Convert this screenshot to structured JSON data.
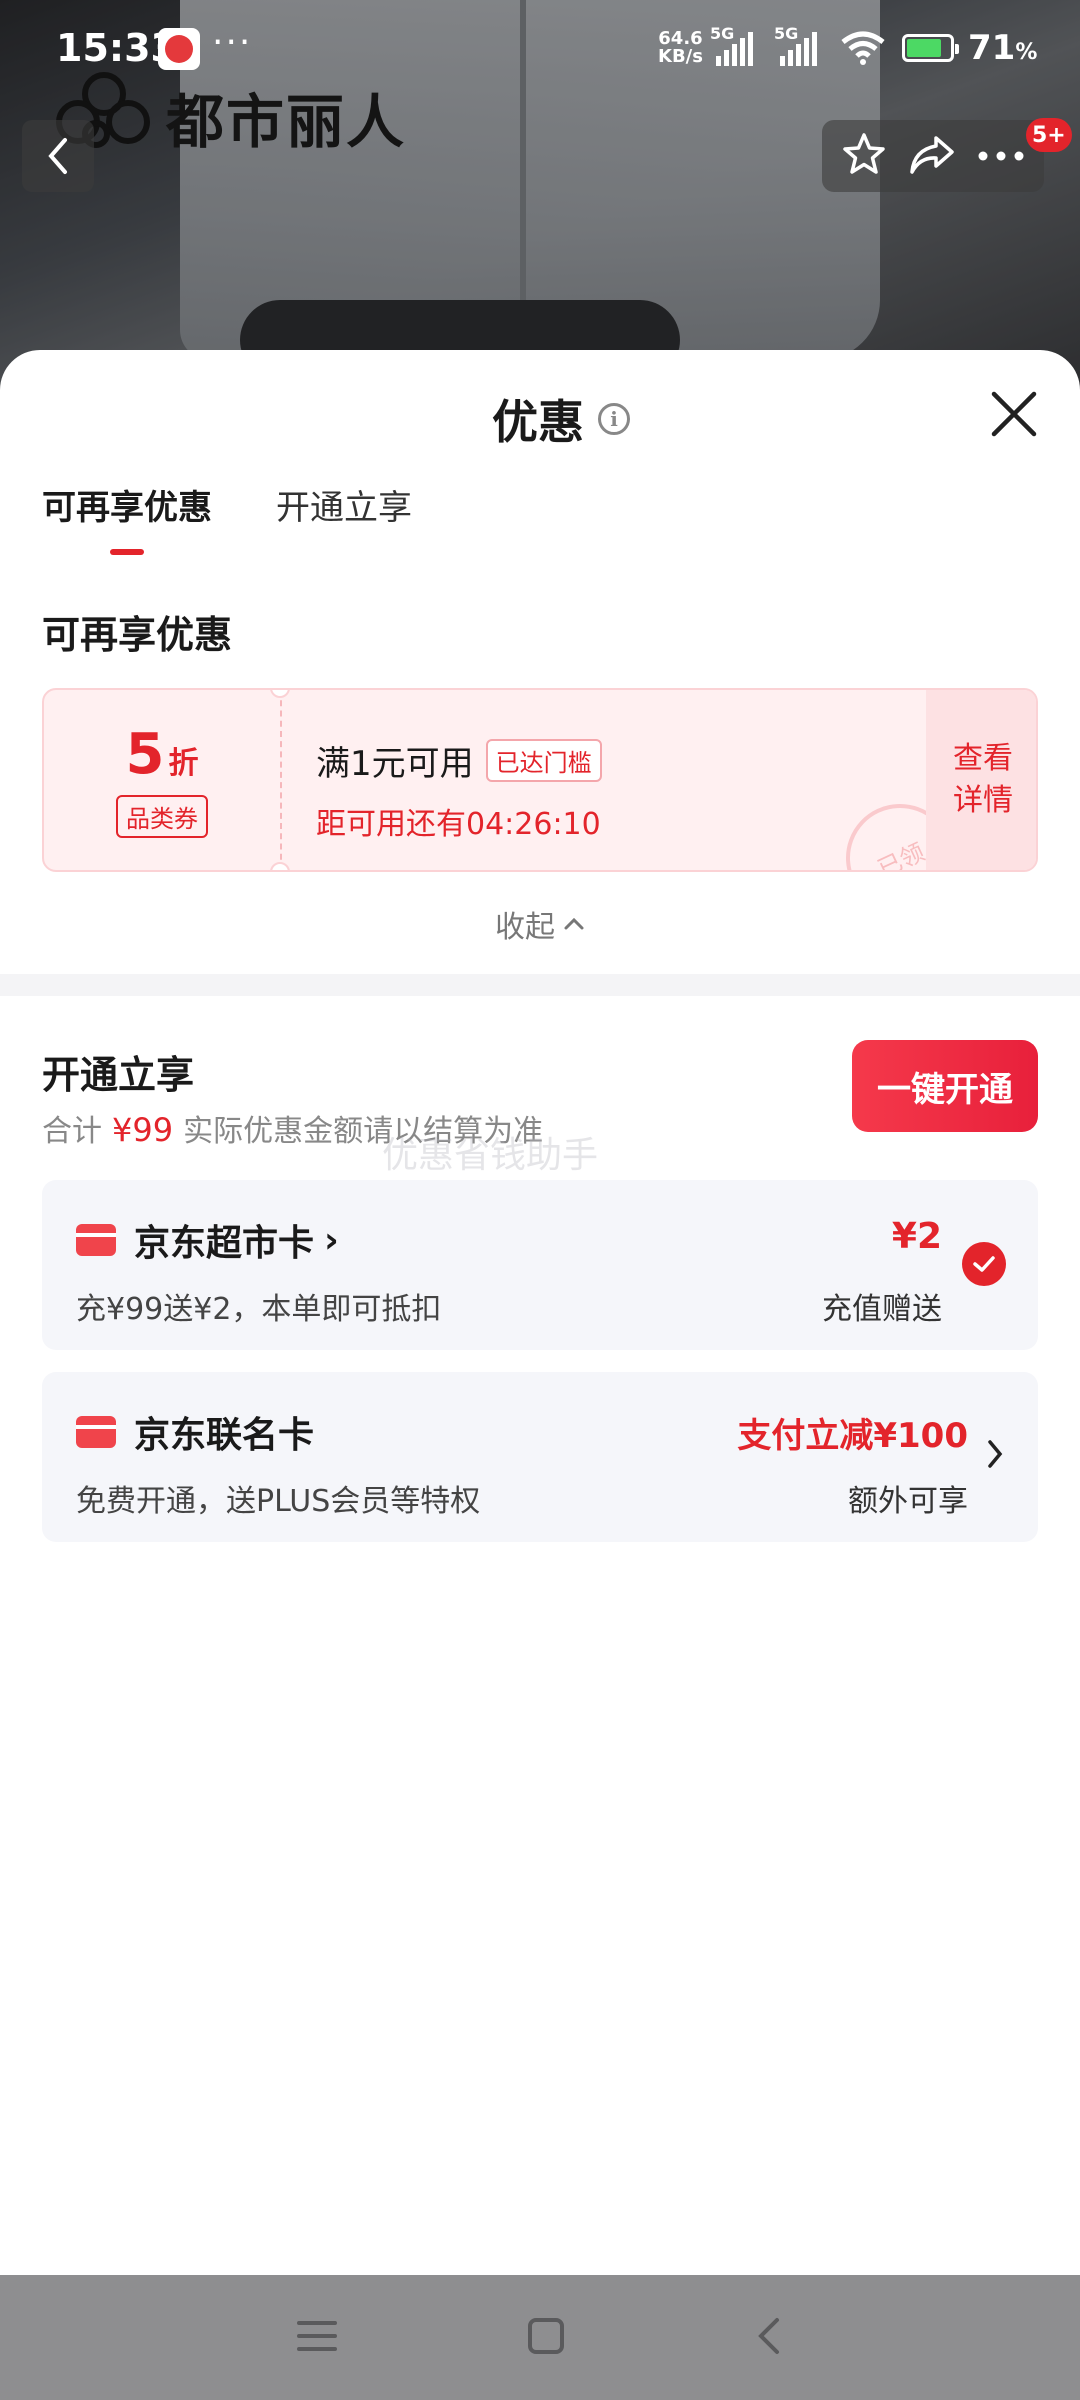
{
  "status_bar": {
    "time": "15:33",
    "more": "···",
    "speed_value": "64.6",
    "speed_unit": "KB/s",
    "sim1_tag": "5G",
    "sim2_tag": "5G",
    "battery_percent": "71",
    "battery_unit": "%"
  },
  "header": {
    "brand_name": "都市丽人",
    "notification_badge": "5+"
  },
  "sheet": {
    "title": "优惠",
    "tabs": [
      {
        "label": "可再享优惠",
        "active": true
      },
      {
        "label": "开通立享",
        "active": false
      }
    ],
    "section_title": "可再享优惠",
    "coupon": {
      "discount": "5",
      "discount_unit": "折",
      "category": "品类券",
      "condition": "满1元可用",
      "threshold_tag": "已达门槛",
      "countdown": "距可用还有04:26:10",
      "details_line1": "查看",
      "details_line2": "详情",
      "stamp": "已领"
    },
    "collapse_label": "收起",
    "open_section": {
      "title": "开通立享",
      "total_label": "合计",
      "total_price": "¥99",
      "note": "实际优惠金额请以结算为准",
      "watermark": "优惠省钱助手",
      "one_click_label": "一键开通"
    },
    "cards": [
      {
        "name": "京东超市卡",
        "name_suffix": "›",
        "desc": "充¥99送¥2，本单即可抵扣",
        "value": "¥2",
        "value_label": "充值赠送",
        "selected": true
      },
      {
        "name": "京东联名卡",
        "desc": "免费开通，送PLUS会员等特权",
        "value": "支付立减¥100",
        "value_label": "额外可享",
        "selected": false
      }
    ]
  },
  "colors": {
    "accent_red": "#e3242b",
    "coupon_bg": "#fff0f1",
    "card_bg": "#f5f6fa",
    "nav_bar": "#8e8e90"
  },
  "icons": {
    "back": "chevron-left-icon",
    "favorite": "star-icon",
    "share": "share-icon",
    "more": "more-icon",
    "info": "info-icon",
    "close": "close-icon",
    "card": "card-icon",
    "check": "check-icon",
    "collapse": "chevron-up-icon",
    "nav_menu": "menu-icon",
    "nav_home": "home-icon",
    "nav_back": "back-icon"
  }
}
